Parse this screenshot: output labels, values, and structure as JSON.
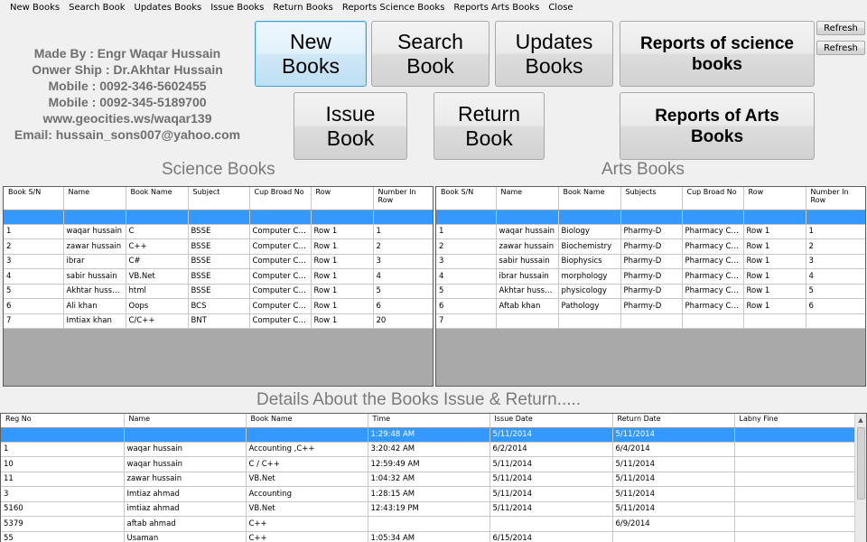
{
  "menu": [
    "New Books",
    "Search Book",
    "Updates Books",
    "Issue Books",
    "Return Books",
    "Reports Science Books",
    "Reports Arts Books",
    "Close"
  ],
  "info": [
    "Made By : Engr Waqar Hussain",
    "Onwer Ship : Dr.Akhtar Hussain",
    "Mobile : 0092-346-5602455",
    "Mobile : 0092-345-5189700",
    "www.geocities.ws/waqar139",
    "Email: hussain_sons007@yahoo.com"
  ],
  "buttons": {
    "new_books": "New Books",
    "search_book": "Search Book",
    "updates_books": "Updates Books",
    "reports_science": "Reports of science books",
    "issue_book": "Issue Book",
    "return_book": "Return Book",
    "reports_arts": "Reports of Arts Books",
    "refresh1": "Refresh",
    "refresh2": "Refresh"
  },
  "titles": {
    "science": "Science Books",
    "arts": "Arts Books",
    "details": "Details About the Books Issue & Return....."
  },
  "science": {
    "columns": [
      "Book S/N",
      "Name",
      "Book Name",
      "Subject",
      "Cup Broad No",
      "Row",
      "Number In Row"
    ],
    "rows": [
      [
        "1",
        "waqar hussain",
        "C",
        "BSSE",
        "Computer Cup...",
        "Row 1",
        "1"
      ],
      [
        "2",
        "zawar hussain",
        "C++",
        "BSSE",
        "Computer Cup...",
        "Row 1",
        "2"
      ],
      [
        "3",
        "ibrar",
        "C#",
        "BSSE",
        "Computer Cup...",
        "Row 1",
        "3"
      ],
      [
        "4",
        "sabir hussain",
        "VB.Net",
        "BSSE",
        "Computer Cup...",
        "Row 1",
        "4"
      ],
      [
        "5",
        "Akhtar hussain",
        "html",
        "BSSE",
        "Computer Cup...",
        "Row 1",
        "5"
      ],
      [
        "6",
        "Ali khan",
        "Oops",
        "BCS",
        "Computer Cup...",
        "Row 1",
        "6"
      ],
      [
        "7",
        "Imtiax khan",
        "C/C++",
        "BNT",
        "Computer Cup...",
        "Row 1",
        "20"
      ]
    ]
  },
  "arts": {
    "columns": [
      "Book S/N",
      "Name",
      "Book Name",
      "Subjects",
      "Cup Broad No",
      "Row",
      "Number In Row"
    ],
    "rows": [
      [
        "1",
        "waqar hussain",
        "Biology",
        "Pharmy-D",
        "Pharmacy Cup...",
        "Row 1",
        "1"
      ],
      [
        "2",
        "zawar hussain",
        "Biochemistry",
        "Pharmy-D",
        "Pharmacy Cup...",
        "Row 1",
        "2"
      ],
      [
        "3",
        "sabir hussain",
        "Biophysics",
        "Pharmy-D",
        "Pharmacy Cup...",
        "Row 1",
        "3"
      ],
      [
        "4",
        "ibrar hussain",
        "morphology",
        "Pharmy-D",
        "Pharmacy Cup...",
        "Row 1",
        "4"
      ],
      [
        "5",
        "Akhtar hussain",
        "physicology",
        "Pharmy-D",
        "Pharmacy Cup...",
        "Row 1",
        "5"
      ],
      [
        "6",
        "Aftab khan",
        "Pathology",
        "Pharmy-D",
        "Pharmacy Cup...",
        "Row 1",
        "6"
      ],
      [
        "7",
        "",
        "",
        "",
        "",
        "",
        ""
      ]
    ]
  },
  "details": {
    "columns": [
      "Reg No",
      "Name",
      "Book Name",
      "Time",
      "Issue Date",
      "Return Date",
      "Labny Fine"
    ],
    "selected_row": [
      "",
      "",
      "",
      "1:29:48 AM",
      "5/11/2014",
      "5/11/2014",
      ""
    ],
    "rows": [
      [
        "1",
        "waqar hussain",
        "Accounting ,C++",
        "3:20:42 AM",
        "6/2/2014",
        "6/4/2014",
        ""
      ],
      [
        "10",
        "waqar hussain",
        "C / C++",
        "12:59:49 AM",
        "5/11/2014",
        "5/11/2014",
        ""
      ],
      [
        "11",
        "zawar hussain",
        "VB.Net",
        "1:04:32 AM",
        "5/11/2014",
        "5/11/2014",
        ""
      ],
      [
        "3",
        "Imtiaz ahmad",
        "Accounting",
        "1:28:15 AM",
        "5/11/2014",
        "5/11/2014",
        ""
      ],
      [
        "5160",
        "imtiaz ahmad",
        "VB.Net",
        "12:43:19 PM",
        "5/11/2014",
        "5/11/2014",
        ""
      ],
      [
        "5379",
        "aftab ahmad",
        "C++",
        "",
        "",
        "6/9/2014",
        ""
      ],
      [
        "55",
        "Usaman",
        "C++",
        "1:05:34 AM",
        "6/15/2014",
        "",
        ""
      ]
    ]
  }
}
